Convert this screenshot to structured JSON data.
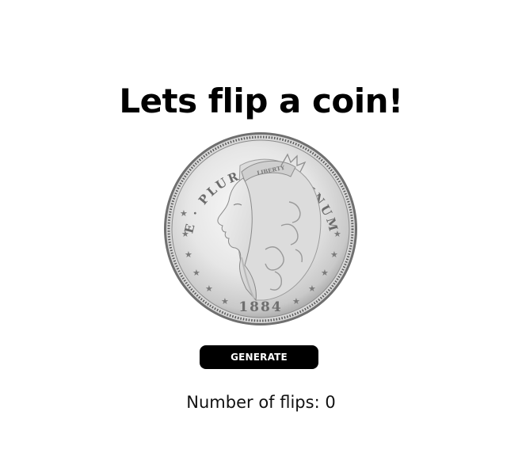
{
  "header": {
    "title": "Lets flip a coin!"
  },
  "coin": {
    "image_name": "morgan-silver-dollar-heads-image",
    "legend_text": "E · PLURIBUS · UNUM",
    "year": "1884",
    "headband_text": "LIBERTY"
  },
  "controls": {
    "generate_label": "GENERATE"
  },
  "counter": {
    "label": "Number of flips: ",
    "value": "0"
  },
  "colors": {
    "button_background": "#000000",
    "button_text": "#ffffff",
    "page_background": "#ffffff"
  }
}
